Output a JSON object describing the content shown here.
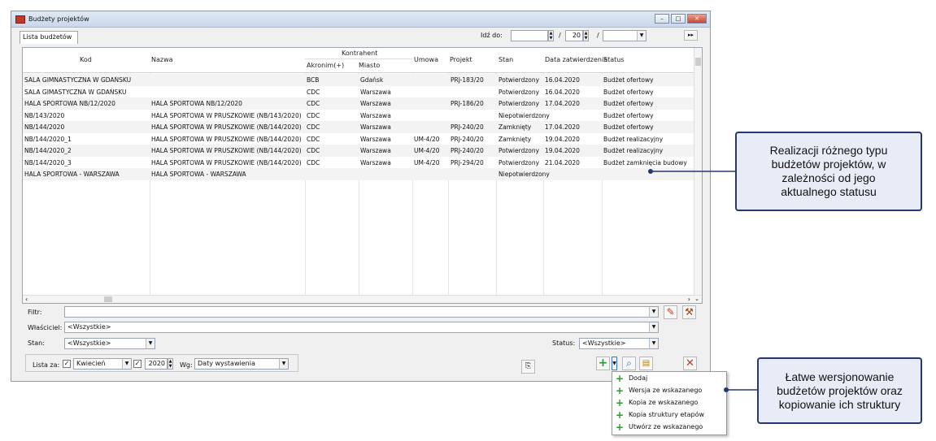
{
  "window": {
    "title": "Budżety projektów"
  },
  "tab": {
    "label": "Lista budżetów"
  },
  "goto": {
    "label": "Idź do:",
    "value2": "20",
    "sep": "/"
  },
  "table": {
    "headers": {
      "kod": "Kod",
      "nazwa": "Nazwa",
      "kontrahent": "Kontrahent",
      "akronim": "Akronim(+)",
      "miasto": "Miasto",
      "umowa": "Umowa",
      "projekt": "Projekt",
      "stan": "Stan",
      "data": "Data zatwierdzenia",
      "status": "Status"
    },
    "rows": [
      {
        "kod": "SALA GIMNASTYCZNA W GDAŃSKU",
        "nazwa": "",
        "akronim": "BCB",
        "miasto": "Gdańsk",
        "umowa": "",
        "projekt": "PRJ-183/20",
        "stan": "Potwierdzony",
        "data": "16.04.2020",
        "status": "Budżet ofertowy"
      },
      {
        "kod": "SALA GIMASTYCZNA W GDAŃSKU",
        "nazwa": "",
        "akronim": "CDC",
        "miasto": "Warszawa",
        "umowa": "",
        "projekt": "",
        "stan": "Potwierdzony",
        "data": "16.04.2020",
        "status": "Budżet ofertowy"
      },
      {
        "kod": "HALA SPORTOWA NB/12/2020",
        "nazwa": "HALA SPORTOWA NB/12/2020",
        "akronim": "CDC",
        "miasto": "Warszawa",
        "umowa": "",
        "projekt": "PRJ-186/20",
        "stan": "Potwierdzony",
        "data": "17.04.2020",
        "status": "Budżet ofertowy"
      },
      {
        "kod": "NB/143/2020",
        "nazwa": "HALA SPORTOWA W PRUSZKOWIE (NB/143/2020)",
        "akronim": "CDC",
        "miasto": "Warszawa",
        "umowa": "",
        "projekt": "",
        "stan": "Niepotwierdzony",
        "data": "",
        "status": "Budżet ofertowy"
      },
      {
        "kod": "NB/144/2020",
        "nazwa": "HALA SPORTOWA W PRUSZKOWIE (NB/144/2020)",
        "akronim": "CDC",
        "miasto": "Warszawa",
        "umowa": "",
        "projekt": "PRJ-240/20",
        "stan": "Zamknięty",
        "data": "17.04.2020",
        "status": "Budżet ofertowy"
      },
      {
        "kod": "NB/144/2020_1",
        "nazwa": "HALA SPORTOWA W PRUSZKOWIE (NB/144/2020)",
        "akronim": "CDC",
        "miasto": "Warszawa",
        "umowa": "UM-4/20",
        "projekt": "PRJ-240/20",
        "stan": "Zamknięty",
        "data": "19.04.2020",
        "status": "Budżet realizacyjny"
      },
      {
        "kod": "NB/144/2020_2",
        "nazwa": "HALA SPORTOWA W PRUSZKOWIE (NB/144/2020)",
        "akronim": "CDC",
        "miasto": "Warszawa",
        "umowa": "UM-4/20",
        "projekt": "PRJ-240/20",
        "stan": "Potwierdzony",
        "data": "19.04.2020",
        "status": "Budżet realizacyjny"
      },
      {
        "kod": "NB/144/2020_3",
        "nazwa": "HALA SPORTOWA W PRUSZKOWIE (NB/144/2020)",
        "akronim": "CDC",
        "miasto": "Warszawa",
        "umowa": "UM-4/20",
        "projekt": "PRJ-294/20",
        "stan": "Potwierdzony",
        "data": "21.04.2020",
        "status": "Budżet zamknięcia budowy"
      },
      {
        "kod": "HALA SPORTOWA - WARSZAWA",
        "nazwa": "HALA SPORTOWA - WARSZAWA",
        "akronim": "",
        "miasto": "",
        "umowa": "",
        "projekt": "",
        "stan": "Niepotwierdzony",
        "data": "",
        "status": ""
      }
    ]
  },
  "filters": {
    "filtr_label": "Filtr:",
    "wlasciciel_label": "Właściciel:",
    "wlasciciel_value": "<Wszystkie>",
    "stan_label": "Stan:",
    "stan_value": "<Wszystkie>",
    "status_label": "Status:",
    "status_value": "<Wszystkie>",
    "lista_za_label": "Lista za:",
    "month": "Kwiecień",
    "year": "2020",
    "wg_label": "Wg:",
    "wg_value": "Daty wystawienia"
  },
  "menu": {
    "items": [
      "Dodaj",
      "Wersja ze wskazanego",
      "Kopia ze wskazanego",
      "Kopia struktury etapów",
      "Utwórz ze wskazanego"
    ]
  },
  "callouts": {
    "top": "Realizacji różnego typu budżetów projektów, w zależności od jego aktualnego statusu",
    "bottom": "Łatwe wersjonowanie budżetów projektów oraz kopiowanie ich struktury"
  },
  "colors": {
    "accent": "#26386f",
    "callout_bg": "#e7ecf6",
    "plus": "#2d9a2d",
    "delete": "#d03020"
  }
}
